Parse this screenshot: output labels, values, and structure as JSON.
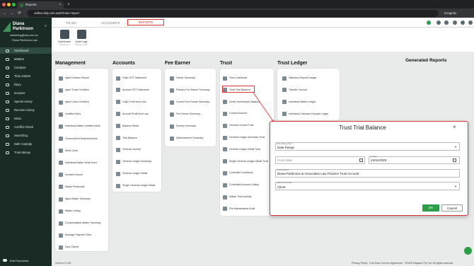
{
  "browser": {
    "tab_title": "Reports",
    "url": "online.silq.com.au/#/main-report",
    "profile_label": "Incognito",
    "new_tab": "+",
    "close_tab": "×",
    "back": "←",
    "forward": "→",
    "reload": "⟳"
  },
  "user": {
    "name_line1": "Diana",
    "name_line2": "Parkinson",
    "email": "marketing@silq.com.au",
    "firm": "Diana Parkinson Law"
  },
  "sidebar": {
    "items": [
      {
        "label": "Dashboard"
      },
      {
        "label": "Matters"
      },
      {
        "label": "Contacts"
      },
      {
        "label": "Time entries"
      },
      {
        "label": "Diary"
      },
      {
        "label": "Invoices"
      },
      {
        "label": "Spend money"
      },
      {
        "label": "Receive money"
      },
      {
        "label": "Inbox"
      },
      {
        "label": "Conflict Check"
      },
      {
        "label": "Searching"
      },
      {
        "label": "Safe Custody"
      },
      {
        "label": "Trust Money"
      }
    ],
    "edit_favourites": "Edit Favourites",
    "version": "Version 3.9.68"
  },
  "topnav": {
    "tabs": [
      "TO DO",
      "ACCOUNTS",
      "REPORTS"
    ]
  },
  "tiles": [
    {
      "label": "Dashboard",
      "sub": "Dashboard"
    },
    {
      "label": "Audit Logs",
      "sub": "Manage Audit"
    }
  ],
  "columns": {
    "management": {
      "title": "Management",
      "items": [
        "Aged Debtors Report",
        "Aged Trade Creditors",
        "Aged Client Creditors",
        "Unbilled Work",
        "Individual Matter Unbilled Work",
        "Unrecovered Disbursements",
        "Work Done",
        "Individual Matter Work Done",
        "Invoices Issued",
        "Matter Financials",
        "Aged Matter Summary",
        "Matter Listing",
        "Compensation Matter Summary",
        "Average Payment Time",
        "New Clients"
      ]
    },
    "accounts": {
      "title": "Accounts",
      "items": [
        "Cash GST Statement",
        "Accrual GST Statement",
        "Cash Profit And Loss",
        "Accrual Profit And Loss",
        "Balance Sheet",
        "Trial Balance",
        "General Journal",
        "General Ledger Summary",
        "General Ledger Detail",
        "Single General Ledger Detail"
      ]
    },
    "fee_earner": {
      "title": "Fee Earner",
      "items": [
        "Owner Summary",
        "Primary Fee Earner Summary",
        "Current Fee Earner Summary",
        "Fee Earner Summary",
        "Sundry Summary",
        "Disbursement Summary"
      ]
    },
    "trust": {
      "title": "Trust",
      "items": [
        "Trust Cashbook",
        "Trust Trial Balance",
        "Debit (Overdrawn) Balance",
        "Control Account",
        "General Journal Trust",
        "General Ledger Summary Trust",
        "General Ledger Detail Trust",
        "Single General Ledger Detail Trust",
        "Controlled Cashbook",
        "Controlled Account Listing",
        "Matter Trust Activity",
        "File Maintenance Audit"
      ]
    },
    "trust_ledger": {
      "title": "Trust Ledger",
      "items": [
        "Statutory Deposit Ledger",
        "Transfer Journal",
        "Individual Matter Ledger",
        "Individual Unknown Deposit Ledger"
      ]
    },
    "generated": {
      "title": "Generated Reports"
    }
  },
  "dialog": {
    "title": "Trust Trial Balance",
    "date_range_label": "Date Range Set *",
    "date_range_value": "Date Range",
    "from_date_placeholder": "From Date",
    "to_date_label": "To Date",
    "to_date_value": "24/11/2025",
    "trust_account_label": "Trust Account",
    "trust_account_value": "Diana Parkinson & Associates Law Practice Trust Account",
    "sort_label": "Select sort order *",
    "sort_value": "Client",
    "ok_label": "OK",
    "cancel_label": "Cancel",
    "close_glyph": "×"
  },
  "footer": {
    "privacy": "Privacy Policy",
    "eula": "End User Licence Agreement",
    "copyright": "©2025 Silqware Pty Ltd. All rights reserved."
  }
}
